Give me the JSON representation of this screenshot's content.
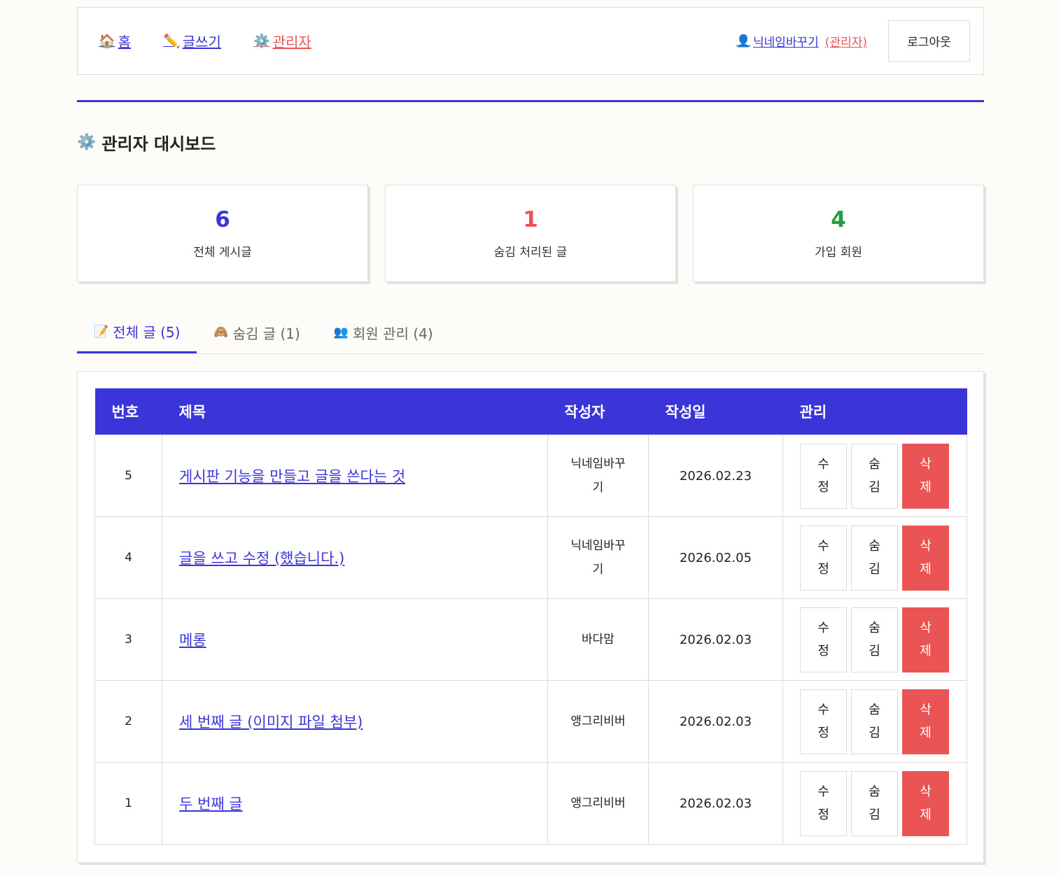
{
  "nav": {
    "home": {
      "icon": "🏠",
      "label": "홈"
    },
    "write": {
      "icon": "✏️",
      "label": "글쓰기"
    },
    "admin": {
      "icon": "⚙️",
      "label": "관리자"
    },
    "user": {
      "icon": "👤",
      "name": "닉네임바꾸기",
      "role": "(관리자)"
    },
    "logout": "로그아웃"
  },
  "page": {
    "icon": "⚙️",
    "title": "관리자 대시보드"
  },
  "stats": [
    {
      "value": "6",
      "label": "전체 게시글",
      "color": "#3b35d9"
    },
    {
      "value": "1",
      "label": "숨김 처리된 글",
      "color": "#ea5455"
    },
    {
      "value": "4",
      "label": "가입 회원",
      "color": "#1e9e3e"
    }
  ],
  "tabs": [
    {
      "icon": "📝",
      "label": "전체 글 (5)"
    },
    {
      "icon": "🙈",
      "label": "숨김 글 (1)"
    },
    {
      "icon": "👥",
      "label": "회원 관리 (4)"
    }
  ],
  "table": {
    "headers": [
      "번호",
      "제목",
      "작성자",
      "작성일",
      "관리"
    ],
    "rows": [
      {
        "num": "5",
        "title": "게시판 기능을 만들고 글을 쓴다는 것",
        "author": "닉네임바꾸기",
        "date": "2026.02.23"
      },
      {
        "num": "4",
        "title": "글을 쓰고 수정 (했습니다.)",
        "author": "닉네임바꾸기",
        "date": "2026.02.05"
      },
      {
        "num": "3",
        "title": "메롱",
        "author": "바다맘",
        "date": "2026.02.03"
      },
      {
        "num": "2",
        "title": "세 번째 글 (이미지 파일 첨부)",
        "author": "앵그리비버",
        "date": "2026.02.03"
      },
      {
        "num": "1",
        "title": "두 번째 글",
        "author": "앵그리비버",
        "date": "2026.02.03"
      }
    ],
    "actions": {
      "edit": "수정",
      "hide": "숨김",
      "delete": "삭제"
    }
  }
}
